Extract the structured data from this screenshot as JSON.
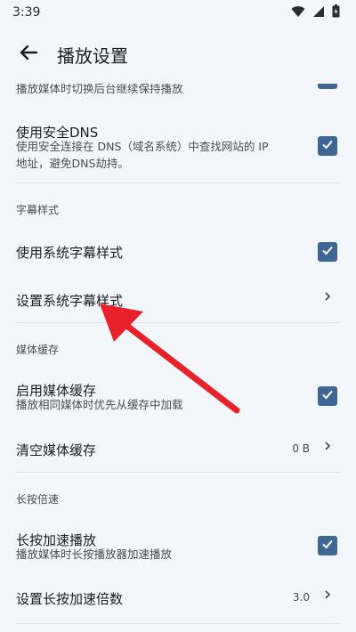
{
  "status": {
    "time": "3:39"
  },
  "appbar": {
    "title": "播放设置"
  },
  "colors": {
    "accent": "#3e6796",
    "arrow": "#e8212a"
  },
  "rows": {
    "background_play": {
      "subtitle": "播放媒体时切换后台继续保持播放"
    },
    "secure_dns": {
      "title": "使用安全DNS",
      "subtitle_line1": "使用安全连接在 DNS（域名系统）中查找网站的 IP",
      "subtitle_line2": "地址，避免DNS劫持。"
    },
    "subtitles_header": "字幕样式",
    "use_system_subtitles": {
      "title": "使用系统字幕样式"
    },
    "set_system_subtitles": {
      "title": "设置系统字幕样式"
    },
    "media_cache_header": "媒体缓存",
    "enable_media_cache": {
      "title": "启用媒体缓存",
      "subtitle": "播放相同媒体时优先从缓存中加载"
    },
    "clear_media_cache": {
      "title": "清空媒体缓存",
      "value": "0 B"
    },
    "long_press_header": "长按倍速",
    "long_press_speedup": {
      "title": "长按加速播放",
      "subtitle": "播放媒体时长按播放器加速播放"
    },
    "long_press_multiplier": {
      "title": "设置长按加速倍数",
      "value": "3.0"
    }
  },
  "icons": {
    "back": "arrow-left-icon",
    "wifi": "wifi-icon",
    "signal": "cellular-signal-icon",
    "battery": "battery-charging-icon",
    "check": "check-icon",
    "chevron": "chevron-right-icon",
    "annotation": "red-pointer-arrow-icon"
  }
}
